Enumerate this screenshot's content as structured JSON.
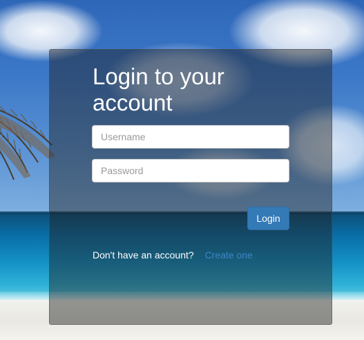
{
  "login": {
    "title": "Login to your account",
    "username_placeholder": "Username",
    "password_placeholder": "Password",
    "login_button": "Login",
    "signup_prompt": "Don't have an account?",
    "signup_link": "Create one"
  },
  "colors": {
    "button": "#337ab7",
    "link": "#3a86c8",
    "panel_overlay": "rgba(30,30,30,0.45)"
  },
  "background": {
    "scene": "beach-with-palm",
    "icon": "palm-frond-icon"
  }
}
